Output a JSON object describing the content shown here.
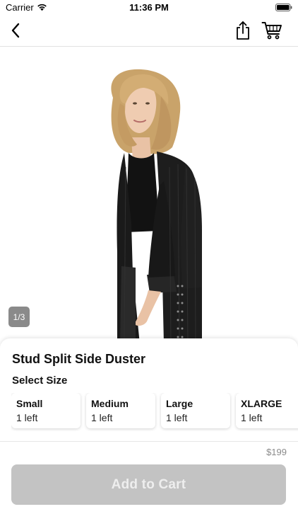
{
  "status_bar": {
    "carrier": "Carrier",
    "time": "11:36 PM"
  },
  "nav": {
    "back_icon": "chevron-left-icon",
    "share_icon": "share-icon",
    "cart_icon": "cart-icon"
  },
  "gallery": {
    "counter": "1/3"
  },
  "product": {
    "title": "Stud Split Side Duster",
    "select_size_label": "Select Size",
    "sizes": [
      {
        "name": "Small",
        "stock": "1 left"
      },
      {
        "name": "Medium",
        "stock": "1 left"
      },
      {
        "name": "Large",
        "stock": "1 left"
      },
      {
        "name": "XLARGE",
        "stock": "1 left"
      }
    ]
  },
  "checkout": {
    "price": "$199",
    "add_to_cart_label": "Add to Cart"
  },
  "colors": {
    "button_disabled_bg": "#c3c3c3",
    "button_disabled_text": "#eeeeee",
    "price_text": "#8a8a8a",
    "counter_badge": "#8a8a8a"
  }
}
